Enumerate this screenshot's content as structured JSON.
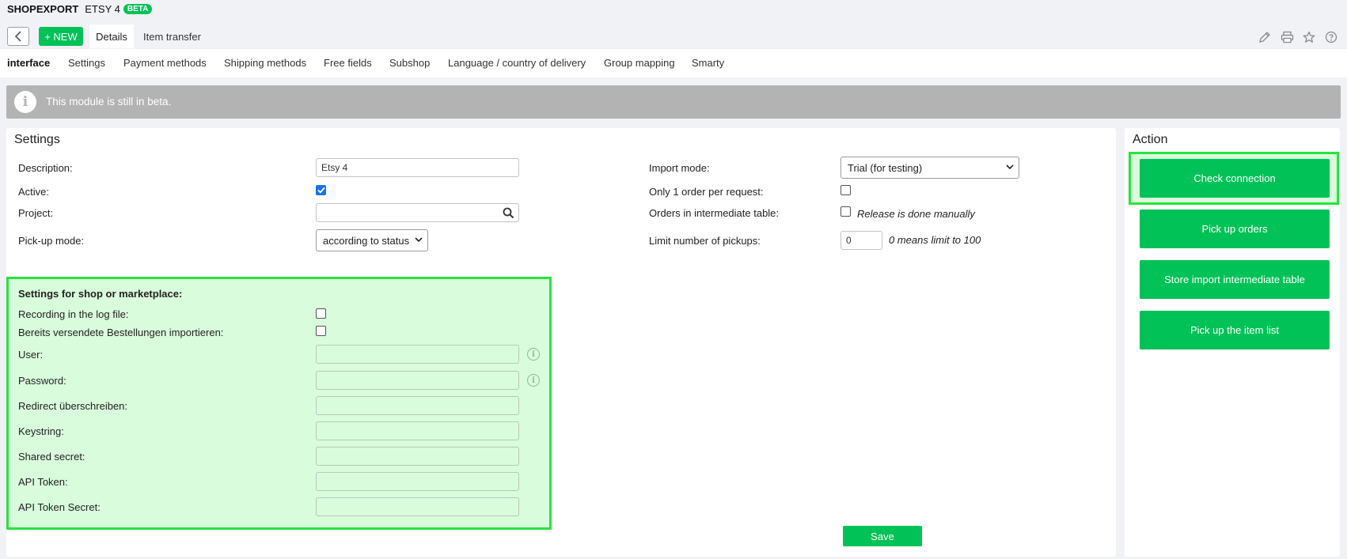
{
  "app": {
    "name": "SHOPEXPORT",
    "module": "ETSY 4",
    "badge": "BETA"
  },
  "toolbar": {
    "new_label": "+ NEW",
    "tabs": [
      "Details",
      "Item transfer"
    ],
    "icons": [
      "pencil-icon",
      "print-icon",
      "star-icon",
      "help-icon"
    ]
  },
  "subnav": {
    "items": [
      "interface",
      "Settings",
      "Payment methods",
      "Shipping methods",
      "Free fields",
      "Subshop",
      "Language / country of delivery",
      "Group mapping",
      "Smarty"
    ],
    "active": "interface"
  },
  "banner": {
    "text": "This module is still in beta."
  },
  "settings": {
    "title": "Settings",
    "left": {
      "description_label": "Description:",
      "description_value": "Etsy 4",
      "active_label": "Active:",
      "active_checked": true,
      "project_label": "Project:",
      "project_value": "",
      "pickup_mode_label": "Pick-up mode:",
      "pickup_mode_value": "according to status"
    },
    "right": {
      "import_mode_label": "Import mode:",
      "import_mode_value": "Trial (for testing)",
      "one_order_label": "Only 1 order per request:",
      "intermediate_label": "Orders in intermediate table:",
      "intermediate_hint": "Release is done manually",
      "limit_label": "Limit number of pickups:",
      "limit_value": "0",
      "limit_hint": "0 means limit to 100"
    },
    "shop": {
      "heading": "Settings for shop or marketplace:",
      "log_label": "Recording in the log file:",
      "shipped_label": "Bereits versendete Bestellungen importieren:",
      "fields": [
        {
          "label": "User:",
          "value": ""
        },
        {
          "label": "Password:",
          "value": ""
        },
        {
          "label": "Redirect überschreiben:",
          "value": ""
        },
        {
          "label": "Keystring:",
          "value": ""
        },
        {
          "label": "Shared secret:",
          "value": ""
        },
        {
          "label": "API Token:",
          "value": ""
        },
        {
          "label": "API Token Secret:",
          "value": ""
        }
      ]
    },
    "save_label": "Save"
  },
  "action": {
    "title": "Action",
    "buttons": [
      "Check connection",
      "Pick up orders",
      "Store import intermediate table",
      "Pick up the item list"
    ]
  },
  "colors": {
    "accent": "#00c257",
    "highlight_border": "#29e33d",
    "highlight_fill": "#d8fcdc",
    "banner": "#b3b3b3",
    "background": "#f1f2f6"
  }
}
